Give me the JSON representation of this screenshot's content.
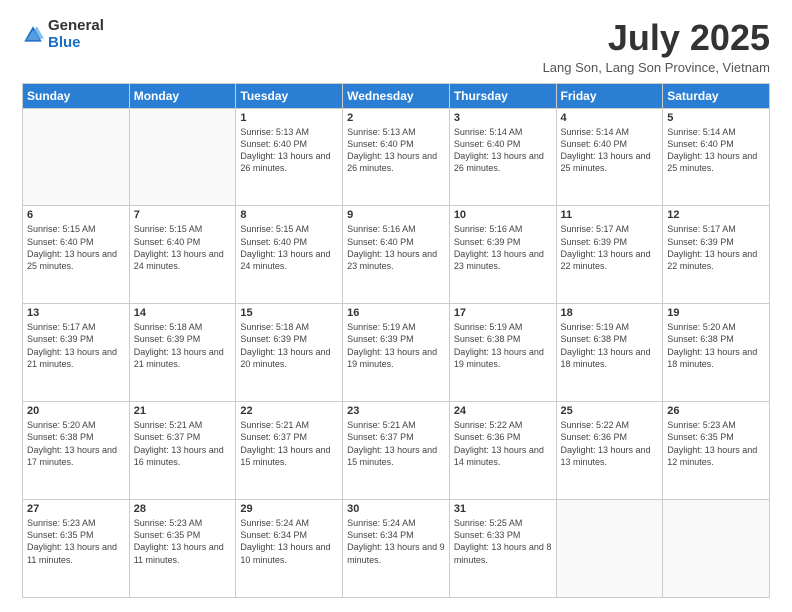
{
  "logo": {
    "general": "General",
    "blue": "Blue"
  },
  "header": {
    "title": "July 2025",
    "subtitle": "Lang Son, Lang Son Province, Vietnam"
  },
  "days_of_week": [
    "Sunday",
    "Monday",
    "Tuesday",
    "Wednesday",
    "Thursday",
    "Friday",
    "Saturday"
  ],
  "weeks": [
    [
      {
        "day": "",
        "info": ""
      },
      {
        "day": "",
        "info": ""
      },
      {
        "day": "1",
        "info": "Sunrise: 5:13 AM\nSunset: 6:40 PM\nDaylight: 13 hours and 26 minutes."
      },
      {
        "day": "2",
        "info": "Sunrise: 5:13 AM\nSunset: 6:40 PM\nDaylight: 13 hours and 26 minutes."
      },
      {
        "day": "3",
        "info": "Sunrise: 5:14 AM\nSunset: 6:40 PM\nDaylight: 13 hours and 26 minutes."
      },
      {
        "day": "4",
        "info": "Sunrise: 5:14 AM\nSunset: 6:40 PM\nDaylight: 13 hours and 25 minutes."
      },
      {
        "day": "5",
        "info": "Sunrise: 5:14 AM\nSunset: 6:40 PM\nDaylight: 13 hours and 25 minutes."
      }
    ],
    [
      {
        "day": "6",
        "info": "Sunrise: 5:15 AM\nSunset: 6:40 PM\nDaylight: 13 hours and 25 minutes."
      },
      {
        "day": "7",
        "info": "Sunrise: 5:15 AM\nSunset: 6:40 PM\nDaylight: 13 hours and 24 minutes."
      },
      {
        "day": "8",
        "info": "Sunrise: 5:15 AM\nSunset: 6:40 PM\nDaylight: 13 hours and 24 minutes."
      },
      {
        "day": "9",
        "info": "Sunrise: 5:16 AM\nSunset: 6:40 PM\nDaylight: 13 hours and 23 minutes."
      },
      {
        "day": "10",
        "info": "Sunrise: 5:16 AM\nSunset: 6:39 PM\nDaylight: 13 hours and 23 minutes."
      },
      {
        "day": "11",
        "info": "Sunrise: 5:17 AM\nSunset: 6:39 PM\nDaylight: 13 hours and 22 minutes."
      },
      {
        "day": "12",
        "info": "Sunrise: 5:17 AM\nSunset: 6:39 PM\nDaylight: 13 hours and 22 minutes."
      }
    ],
    [
      {
        "day": "13",
        "info": "Sunrise: 5:17 AM\nSunset: 6:39 PM\nDaylight: 13 hours and 21 minutes."
      },
      {
        "day": "14",
        "info": "Sunrise: 5:18 AM\nSunset: 6:39 PM\nDaylight: 13 hours and 21 minutes."
      },
      {
        "day": "15",
        "info": "Sunrise: 5:18 AM\nSunset: 6:39 PM\nDaylight: 13 hours and 20 minutes."
      },
      {
        "day": "16",
        "info": "Sunrise: 5:19 AM\nSunset: 6:39 PM\nDaylight: 13 hours and 19 minutes."
      },
      {
        "day": "17",
        "info": "Sunrise: 5:19 AM\nSunset: 6:38 PM\nDaylight: 13 hours and 19 minutes."
      },
      {
        "day": "18",
        "info": "Sunrise: 5:19 AM\nSunset: 6:38 PM\nDaylight: 13 hours and 18 minutes."
      },
      {
        "day": "19",
        "info": "Sunrise: 5:20 AM\nSunset: 6:38 PM\nDaylight: 13 hours and 18 minutes."
      }
    ],
    [
      {
        "day": "20",
        "info": "Sunrise: 5:20 AM\nSunset: 6:38 PM\nDaylight: 13 hours and 17 minutes."
      },
      {
        "day": "21",
        "info": "Sunrise: 5:21 AM\nSunset: 6:37 PM\nDaylight: 13 hours and 16 minutes."
      },
      {
        "day": "22",
        "info": "Sunrise: 5:21 AM\nSunset: 6:37 PM\nDaylight: 13 hours and 15 minutes."
      },
      {
        "day": "23",
        "info": "Sunrise: 5:21 AM\nSunset: 6:37 PM\nDaylight: 13 hours and 15 minutes."
      },
      {
        "day": "24",
        "info": "Sunrise: 5:22 AM\nSunset: 6:36 PM\nDaylight: 13 hours and 14 minutes."
      },
      {
        "day": "25",
        "info": "Sunrise: 5:22 AM\nSunset: 6:36 PM\nDaylight: 13 hours and 13 minutes."
      },
      {
        "day": "26",
        "info": "Sunrise: 5:23 AM\nSunset: 6:35 PM\nDaylight: 13 hours and 12 minutes."
      }
    ],
    [
      {
        "day": "27",
        "info": "Sunrise: 5:23 AM\nSunset: 6:35 PM\nDaylight: 13 hours and 11 minutes."
      },
      {
        "day": "28",
        "info": "Sunrise: 5:23 AM\nSunset: 6:35 PM\nDaylight: 13 hours and 11 minutes."
      },
      {
        "day": "29",
        "info": "Sunrise: 5:24 AM\nSunset: 6:34 PM\nDaylight: 13 hours and 10 minutes."
      },
      {
        "day": "30",
        "info": "Sunrise: 5:24 AM\nSunset: 6:34 PM\nDaylight: 13 hours and 9 minutes."
      },
      {
        "day": "31",
        "info": "Sunrise: 5:25 AM\nSunset: 6:33 PM\nDaylight: 13 hours and 8 minutes."
      },
      {
        "day": "",
        "info": ""
      },
      {
        "day": "",
        "info": ""
      }
    ]
  ]
}
